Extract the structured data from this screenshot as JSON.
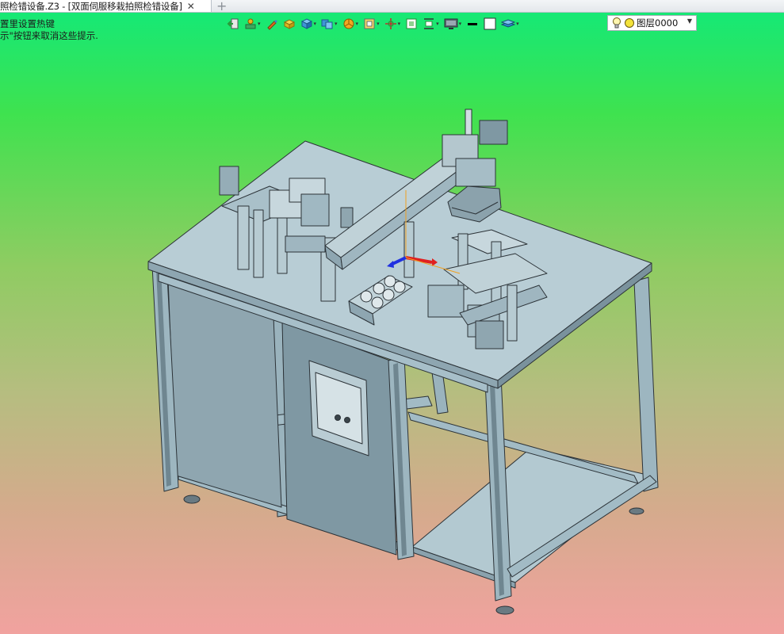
{
  "tab": {
    "title": "照检错设备.Z3 - [双面伺服移栽拍照检错设备]",
    "close_glyph": "✕",
    "new_tab_glyph": "+"
  },
  "hints": {
    "line1": "置里设置热键",
    "line2": "示\"按钮来取消这些提示."
  },
  "toolbar": {
    "tools": [
      {
        "name": "exit-icon",
        "has_menu": false
      },
      {
        "name": "sketch-icon",
        "has_menu": true
      },
      {
        "name": "pencil-icon",
        "has_menu": false
      },
      {
        "name": "cube-yellow-icon",
        "has_menu": false
      },
      {
        "name": "cube-blue-icon",
        "has_menu": true
      },
      {
        "name": "copy-cube-icon",
        "has_menu": true
      },
      {
        "name": "pie-icon",
        "has_menu": true
      },
      {
        "name": "frame-icon",
        "has_menu": true
      },
      {
        "name": "move-icon",
        "has_menu": true
      },
      {
        "name": "view-icon",
        "has_menu": false
      },
      {
        "name": "align-icon",
        "has_menu": true
      },
      {
        "name": "display-icon",
        "has_menu": true
      },
      {
        "name": "line-black-icon",
        "has_menu": false
      },
      {
        "name": "square-white-icon",
        "has_menu": false
      },
      {
        "name": "layers-icon",
        "has_menu": true
      }
    ],
    "caret_glyph": "▾"
  },
  "layer": {
    "value": "图层0000",
    "dropdown_glyph": "▼"
  },
  "colors": {
    "metal_light": "#a9c2cc",
    "metal_mid": "#86a0ab",
    "metal_dark": "#5b737d",
    "outline": "#2c3338"
  }
}
